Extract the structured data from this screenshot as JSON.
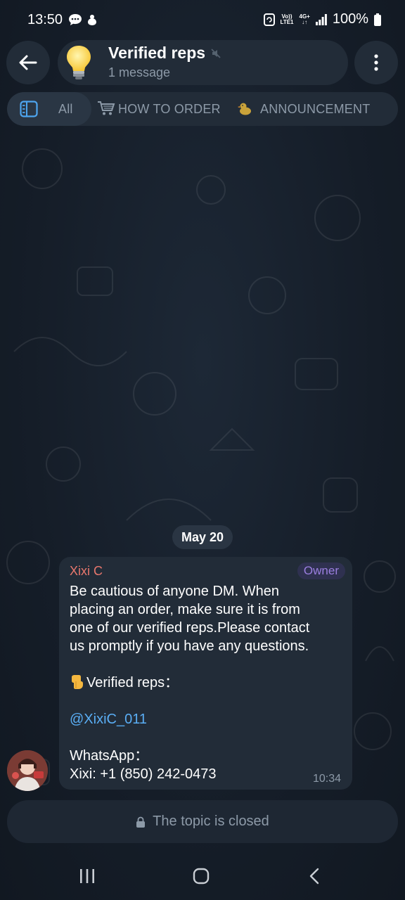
{
  "status_bar": {
    "time": "13:50",
    "volte_top": "Vo))",
    "volte_bottom": "LTE1",
    "network": "4G+",
    "battery": "100%"
  },
  "header": {
    "title": "Verified reps",
    "subtitle": "1 message"
  },
  "tabs": [
    {
      "label": "All"
    },
    {
      "label": "HOW TO ORDER"
    },
    {
      "label": "ANNOUNCEMENT"
    }
  ],
  "date_chip": "May 20",
  "message": {
    "sender": "Xixi C",
    "role": "Owner",
    "lines": [
      "Be cautious of anyone DM. When",
      "placing an order, make sure it is from",
      "one of our verified reps.Please contact",
      "us promptly if you have any questions."
    ],
    "verified_label": "Verified reps：",
    "mention": "@XixiC_011",
    "whatsapp_label": "WhatsApp：",
    "contact": "Xixi: +1 (850) 242-0473",
    "time": "10:34"
  },
  "closed_bar": {
    "text": "The topic is closed"
  },
  "colors": {
    "background": "#141c26",
    "panel": "#222c38",
    "sender": "#e8776d",
    "role": "#9b7fe0",
    "mention": "#5aaef5",
    "muted_text": "#8d9aa8"
  },
  "icons": {
    "back": "arrow-left-icon",
    "menu": "kebab-menu-icon",
    "bulb": "light-bulb-icon",
    "sidebar": "sidebar-toggle-icon",
    "cart": "shopping-cart-icon",
    "announcement": "duck-icon",
    "lock": "lock-icon"
  }
}
